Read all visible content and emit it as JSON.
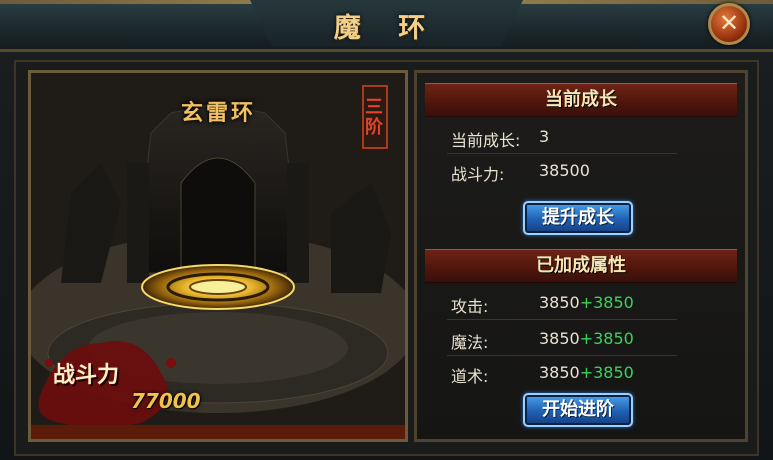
{
  "window": {
    "title": "魔 环",
    "close_icon": "close-x-icon"
  },
  "scene": {
    "ring_name": "玄雷环",
    "stage_badge": "三阶",
    "power_label": "战斗力",
    "power_value": "77000"
  },
  "growth": {
    "header": "当前成长",
    "current_growth_label": "当前成长:",
    "current_growth_value": "3",
    "power_label": "战斗力:",
    "power_value": "38500",
    "button": "提升成长"
  },
  "attributes": {
    "header": "已加成属性",
    "rows": [
      {
        "label": "攻击:",
        "base": "3850",
        "bonus": "+3850"
      },
      {
        "label": "魔法:",
        "base": "3850",
        "bonus": "+3850"
      },
      {
        "label": "道术:",
        "base": "3850",
        "bonus": "+3850"
      }
    ],
    "button": "开始进阶"
  },
  "colors": {
    "bonus": "#3ed15c",
    "title": "#f3d08a",
    "button": "#1f5fb4"
  }
}
